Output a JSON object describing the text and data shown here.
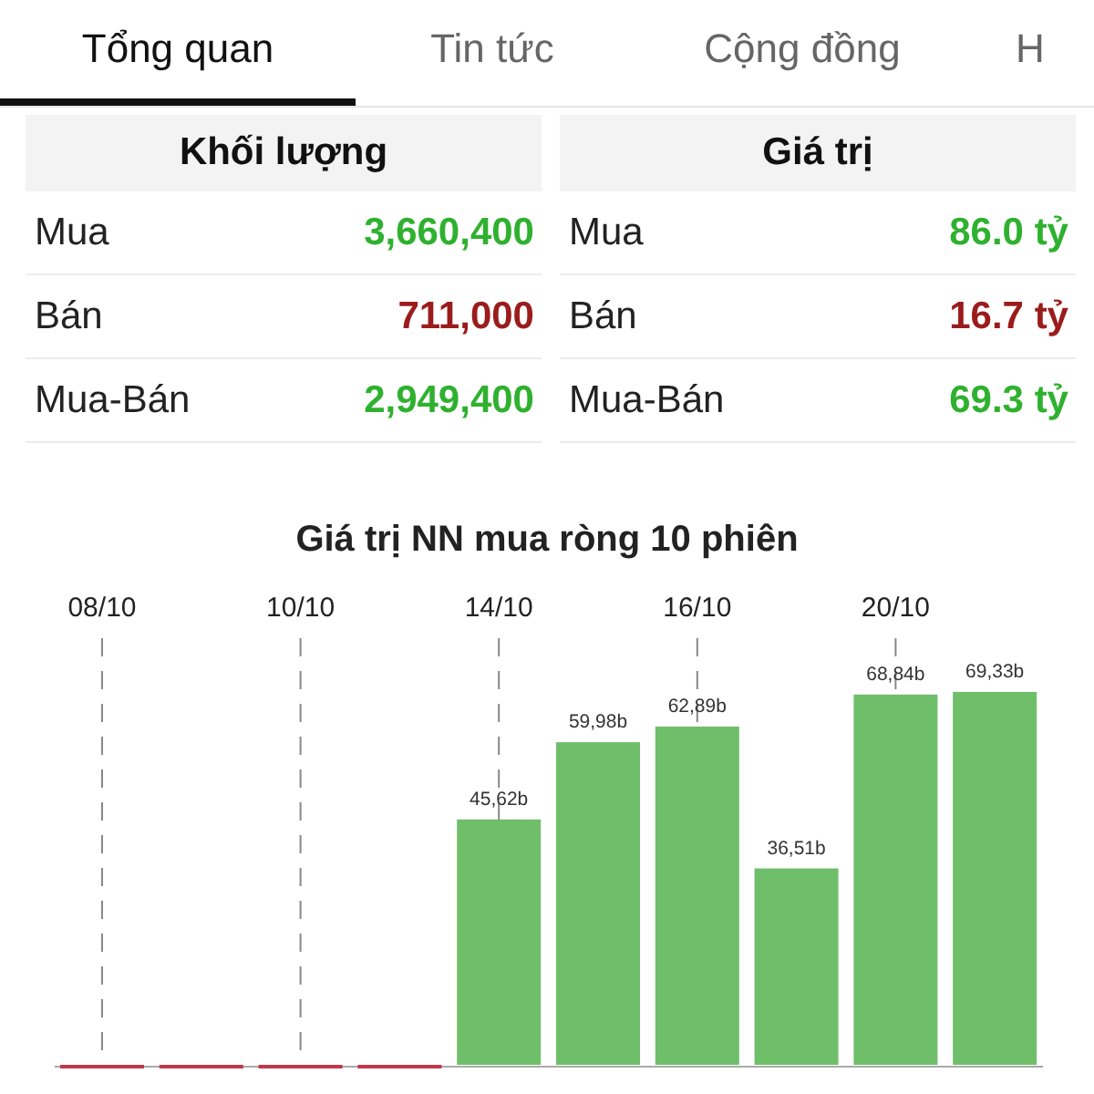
{
  "tabs": [
    {
      "label": "Tổng quan",
      "selected": true
    },
    {
      "label": "Tin tức",
      "selected": false
    },
    {
      "label": "Cộng đồng",
      "selected": false
    },
    {
      "label": "H",
      "selected": false
    }
  ],
  "panels": [
    {
      "title": "Khối lượng",
      "rows": [
        {
          "label": "Mua",
          "value": "3,660,400",
          "color": "#2fb12f"
        },
        {
          "label": "Bán",
          "value": "711,000",
          "color": "#9b1c1c"
        },
        {
          "label": "Mua-Bán",
          "value": "2,949,400",
          "color": "#2fb12f"
        }
      ]
    },
    {
      "title": "Giá trị",
      "rows": [
        {
          "label": "Mua",
          "value": "86.0 tỷ",
          "color": "#2fb12f"
        },
        {
          "label": "Bán",
          "value": "16.7 tỷ",
          "color": "#9b1c1c"
        },
        {
          "label": "Mua-Bán",
          "value": "69.3 tỷ",
          "color": "#2fb12f"
        }
      ]
    }
  ],
  "chart": {
    "chart_data": {
      "type": "bar",
      "grid": true,
      "title": "Giá trị NN mua ròng 10 phiên",
      "categories": [
        "08/10",
        null,
        "10/10",
        null,
        "14/10",
        null,
        "16/10",
        null,
        "20/10",
        null
      ],
      "values": [
        0,
        0,
        0,
        0,
        45.62,
        59.98,
        62.89,
        36.51,
        68.84,
        69.33
      ],
      "value_labels": [
        null,
        null,
        null,
        null,
        "45,62b",
        "59,98b",
        "62,89b",
        "36,51b",
        "68,84b",
        "69,33b"
      ]
    }
  }
}
